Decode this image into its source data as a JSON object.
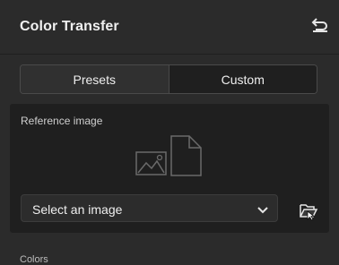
{
  "header": {
    "title": "Color Transfer",
    "reset_icon": "undo-arrow-icon"
  },
  "tabs": [
    {
      "label": "Presets",
      "active": false
    },
    {
      "label": "Custom",
      "active": true
    }
  ],
  "reference": {
    "label": "Reference image",
    "placeholder_icon": "image-document-icon",
    "select": {
      "value": "Select an image",
      "icon": "chevron-down-icon"
    },
    "open_icon": "folder-open-icon"
  },
  "footer": {
    "partial_label": "Colors"
  },
  "colors": {
    "background": "#2b2b2b",
    "panel": "#1f1f1f",
    "tab_active": "#1f1f1f",
    "tab_inactive": "#303030",
    "text": "#efefef"
  }
}
